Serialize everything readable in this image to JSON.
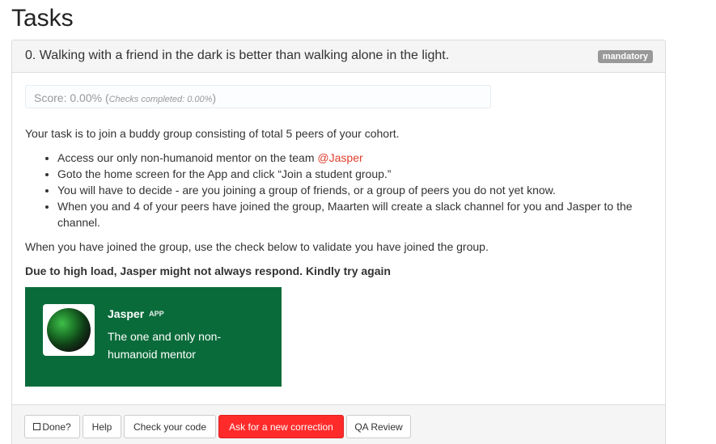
{
  "page": {
    "title": "Tasks"
  },
  "task": {
    "title": "0. Walking with a friend in the dark is better than walking alone in the light.",
    "badge": "mandatory",
    "score": {
      "label": "Score: 0.00% (",
      "checks": "Checks completed: 0.00%",
      "close": ")"
    },
    "intro": "Your task is to join a buddy group consisting of total 5 peers of your cohort.",
    "bullets": [
      {
        "text": "Access our only non-humanoid mentor on the team ",
        "mention": "@Jasper"
      },
      {
        "text": "Goto the home screen for the App and click “Join a student group.”"
      },
      {
        "text": "You will have to decide - are you joining a group of friends, or a group of peers you do not yet know."
      },
      {
        "text": "When you and 4 of your peers have joined the group, Maarten will create a slack channel for you and Jasper to the channel."
      }
    ],
    "after": "When you have joined the group, use the check below to validate you have joined the group.",
    "warning": "Due to high load, Jasper might not always respond. Kindly try again",
    "mentor": {
      "name": "Jasper",
      "tag": "APP",
      "description": "The one and only non-humanoid mentor",
      "avatar_icon": "green-opal-icon"
    }
  },
  "footer": {
    "done_label": "Done?",
    "help_label": "Help",
    "check_label": "Check your code",
    "correction_label": "Ask for a new correction",
    "qa_label": "QA Review"
  },
  "colors": {
    "danger": "#ff2b2b",
    "mention": "#e03e2d",
    "card": "#0a6b3a",
    "badge": "#999999"
  }
}
